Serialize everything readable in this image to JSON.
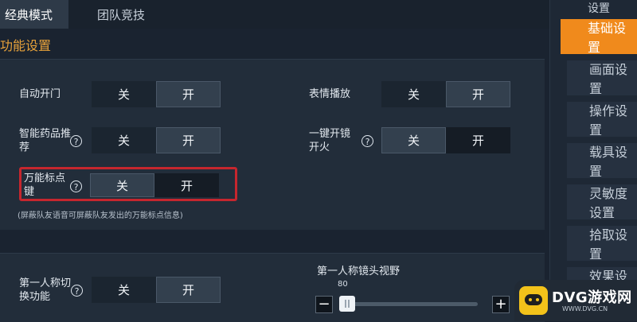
{
  "tabs": {
    "classic": "经典模式",
    "team": "团队竞技"
  },
  "section_title": "功能设置",
  "toggle_labels": {
    "off": "关",
    "on": "开"
  },
  "settings": {
    "auto_door": "自动开门",
    "emote": "表情播放",
    "smart_med": "智能药品推荐",
    "scope_fire": "一键开镜开火",
    "universal_mark": "万能标点键",
    "universal_note": "(屏蔽队友语音可屏蔽队友发出的万能标点信息)",
    "first_person_switch": "第一人称切换功能"
  },
  "slider": {
    "title": "第一人称镜头视野",
    "value": "80",
    "minus": "−",
    "plus": "+"
  },
  "right_menu": {
    "title": "设置",
    "items": [
      "基础设置",
      "画面设置",
      "操作设置",
      "载具设置",
      "灵敏度设置",
      "拾取设置",
      "效果设置"
    ]
  },
  "watermark": {
    "brand": "DVG游戏网",
    "url": "WWW.DVG.CN"
  },
  "colors": {
    "accent": "#f08a1c",
    "highlight_box": "#c6262e"
  }
}
